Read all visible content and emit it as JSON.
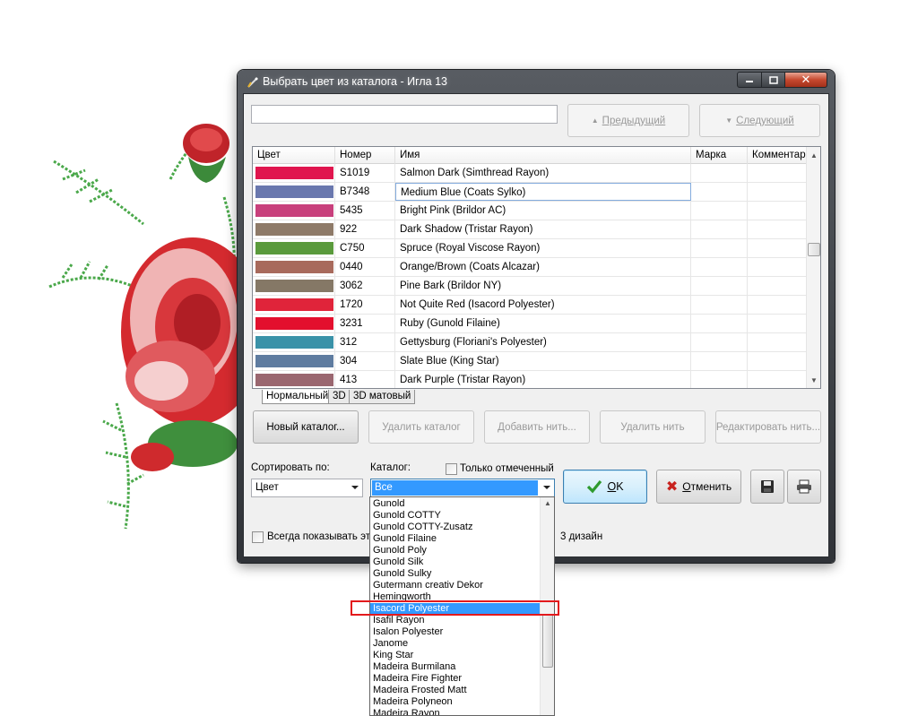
{
  "window": {
    "title": "Выбрать цвет из каталога - Игла 13"
  },
  "search": {
    "value": "",
    "placeholder": ""
  },
  "nav": {
    "prev_label": "Предыдущий",
    "next_label": "Следующий"
  },
  "table": {
    "columns": [
      "Цвет",
      "Номер",
      "Имя",
      "Марка",
      "Комментар"
    ],
    "rows": [
      {
        "color": "#e0154e",
        "number": "S1019",
        "name": "Salmon Dark (Simthread Rayon)"
      },
      {
        "color": "#6a78ae",
        "number": "B7348",
        "name": "Medium Blue (Coats Sylko)"
      },
      {
        "color": "#c8407c",
        "number": "5435",
        "name": "Bright Pink (Brildor AC)"
      },
      {
        "color": "#8e7a68",
        "number": "922",
        "name": "Dark Shadow (Tristar Rayon)"
      },
      {
        "color": "#5a9a3c",
        "number": "C750",
        "name": "Spruce (Royal Viscose Rayon)"
      },
      {
        "color": "#a86a5c",
        "number": "0440",
        "name": "Orange/Brown (Coats Alcazar)"
      },
      {
        "color": "#857866",
        "number": "3062",
        "name": "Pine Bark (Brildor NY)"
      },
      {
        "color": "#e0243a",
        "number": "1720",
        "name": "Not Quite Red (Isacord Polyester)"
      },
      {
        "color": "#e30f2d",
        "number": "3231",
        "name": "Ruby (Gunold Filaine)"
      },
      {
        "color": "#3a92a8",
        "number": "312",
        "name": "Gettysburg (Floriani's Polyester)"
      },
      {
        "color": "#5f7ca0",
        "number": "304",
        "name": "Slate Blue (King Star)"
      },
      {
        "color": "#9a6770",
        "number": "413",
        "name": "Dark Purple (Tristar Rayon)"
      }
    ]
  },
  "tabs": [
    "Нормальный",
    "3D",
    "3D матовый"
  ],
  "actions": {
    "new_catalog": "Новый каталог...",
    "delete_catalog": "Удалить каталог",
    "add_thread": "Добавить нить...",
    "delete_thread": "Удалить нить",
    "edit_thread": "Редактировать нить..."
  },
  "sort": {
    "label": "Сортировать по:",
    "value": "Цвет"
  },
  "catalog": {
    "label": "Каталог:",
    "value": "Все"
  },
  "only_marked_label": "Только отмеченный",
  "always_show_label": "Всегда показывать это",
  "design_fragment": "3 дизайн",
  "ok": {
    "underlined": "О",
    "rest": "K"
  },
  "cancel": {
    "underlined": "О",
    "rest": "тменить"
  },
  "dropdown": {
    "items": [
      "Gunold",
      "Gunold COTTY",
      "Gunold COTTY-Zusatz",
      "Gunold Filaine",
      "Gunold Poly",
      "Gunold Silk",
      "Gunold Sulky",
      "Gutermann creativ Dekor",
      "Hemingworth",
      "Isacord Polyester",
      "Isafil Rayon",
      "Isalon Polyester",
      "Janome",
      "King Star",
      "Madeira Burmilana",
      "Madeira Fire Fighter",
      "Madeira Frosted Matt",
      "Madeira Polyneon",
      "Madeira Rayon"
    ],
    "selected_index": 9
  },
  "colors": {
    "selection": "#3399ff",
    "highlight_box": "#e3191c",
    "close_button": "#c7492f"
  }
}
